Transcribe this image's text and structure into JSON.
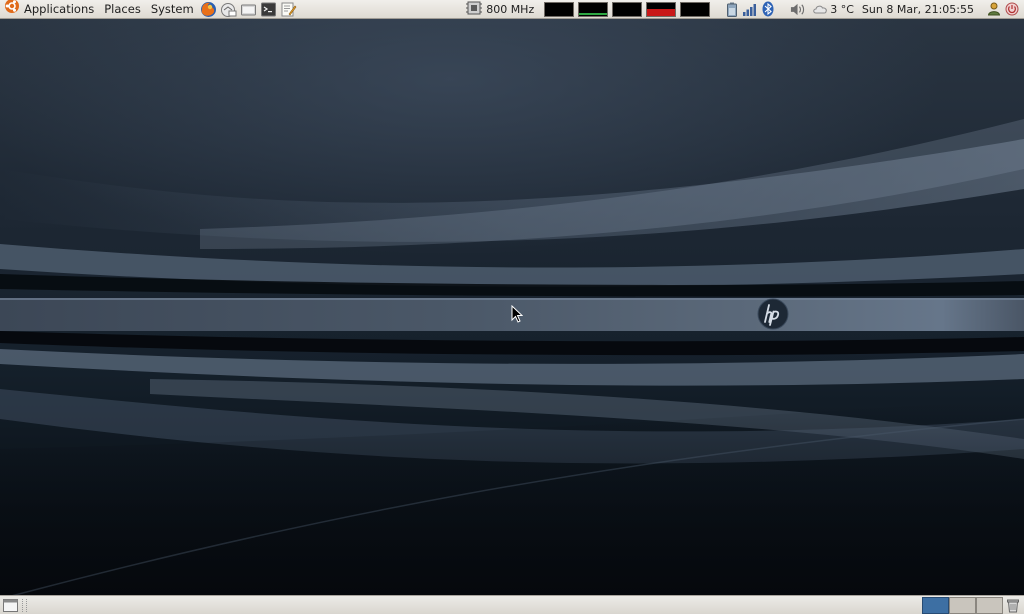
{
  "top_panel": {
    "menus": {
      "applications": "Applications",
      "places": "Places",
      "system": "System"
    },
    "launchers": [
      "firefox-icon",
      "email-icon",
      "files-icon",
      "terminal-icon",
      "text-editor-icon"
    ],
    "cpufreq": {
      "value": "800 MHz"
    },
    "system_monitors": [
      {
        "name": "cpu-monitor",
        "color": "#000000"
      },
      {
        "name": "memory-monitor",
        "color": "#2ea843"
      },
      {
        "name": "network-monitor",
        "color": "#000000"
      },
      {
        "name": "swap-monitor",
        "color": "#c81818"
      },
      {
        "name": "load-monitor",
        "color": "#000000"
      }
    ],
    "tray_icons": [
      "battery-icon",
      "signal-bars-icon",
      "bluetooth-icon",
      "volume-icon"
    ],
    "weather": {
      "icon": "cloud-icon",
      "temperature": "3 °C"
    },
    "clock": "Sun  8 Mar, 21:05:55",
    "user_icons": [
      "user-switch-icon",
      "power-icon"
    ]
  },
  "desktop": {
    "wallpaper": "hp-wallpaper",
    "accent_colors": {
      "band": "#5c6a7b",
      "dark": "#0a1118"
    }
  },
  "bottom_panel": {
    "workspaces": [
      {
        "name": "workspace-1",
        "active": true
      },
      {
        "name": "workspace-2",
        "active": false
      },
      {
        "name": "workspace-3",
        "active": false
      }
    ],
    "trash_icon": "trash-icon"
  }
}
